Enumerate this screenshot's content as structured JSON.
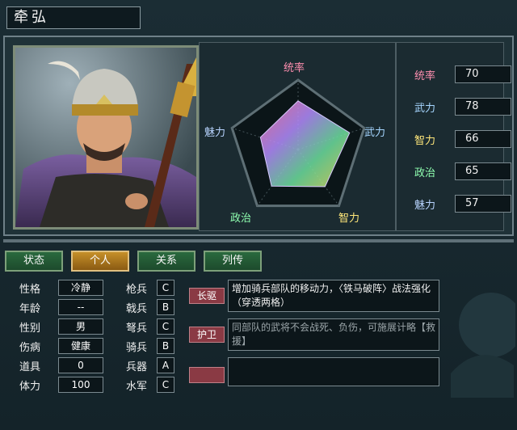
{
  "general": {
    "name": "牵弘"
  },
  "radar": {
    "labels": {
      "tongshuai": "统率",
      "wuli": "武力",
      "zhili": "智力",
      "zhengzhi": "政治",
      "meili": "魅力"
    },
    "values": {
      "tongshuai": 70,
      "wuli": 78,
      "zhili": 66,
      "zhengzhi": 65,
      "meili": 57
    },
    "max": 100
  },
  "stats": [
    {
      "label": "统率",
      "value": "70",
      "color": "#ff8fb0"
    },
    {
      "label": "武力",
      "value": "78",
      "color": "#a6d6ff"
    },
    {
      "label": "智力",
      "value": "66",
      "color": "#ffe77a"
    },
    {
      "label": "政治",
      "value": "65",
      "color": "#8fffb0"
    },
    {
      "label": "魅力",
      "value": "57",
      "color": "#b8d4ff"
    }
  ],
  "tabs": [
    {
      "label": "状态",
      "active": false
    },
    {
      "label": "个人",
      "active": true
    },
    {
      "label": "关系",
      "active": false
    },
    {
      "label": "列传",
      "active": false
    }
  ],
  "info": [
    {
      "label": "性格",
      "value": "冷静"
    },
    {
      "label": "年龄",
      "value": "--"
    },
    {
      "label": "性别",
      "value": "男"
    },
    {
      "label": "伤病",
      "value": "健康"
    },
    {
      "label": "道具",
      "value": "0"
    },
    {
      "label": "体力",
      "value": "100"
    }
  ],
  "aptitudes": [
    {
      "label": "枪兵",
      "value": "C"
    },
    {
      "label": "戟兵",
      "value": "B"
    },
    {
      "label": "弩兵",
      "value": "C"
    },
    {
      "label": "骑兵",
      "value": "B"
    },
    {
      "label": "兵器",
      "value": "A"
    },
    {
      "label": "水军",
      "value": "C"
    }
  ],
  "skills": [
    {
      "name": "长驱",
      "desc": "增加骑兵部队的移动力，〈铁马破阵〉战法强化（穿透两格）",
      "dim": false
    },
    {
      "name": "护卫",
      "desc": "同部队的武将不会战死、负伤，可施展计略【救援】",
      "dim": true
    },
    {
      "name": "",
      "desc": "",
      "dim": false
    }
  ]
}
